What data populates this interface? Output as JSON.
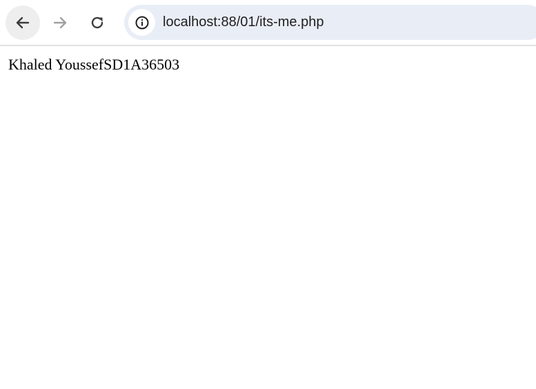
{
  "browser": {
    "address_bar": {
      "url": "localhost:88/01/its-me.php",
      "site_info_icon": "info-circle-icon"
    },
    "buttons": {
      "back_icon": "arrow-left-icon",
      "forward_icon": "arrow-right-icon",
      "reload_icon": "reload-icon"
    },
    "colors": {
      "omnibox_bg": "#e9edf6",
      "toolbar_border": "#dfe1e5",
      "forward_disabled": "#a0a0a0"
    }
  },
  "page": {
    "body_text": "Khaled YoussefSD1A36503"
  }
}
